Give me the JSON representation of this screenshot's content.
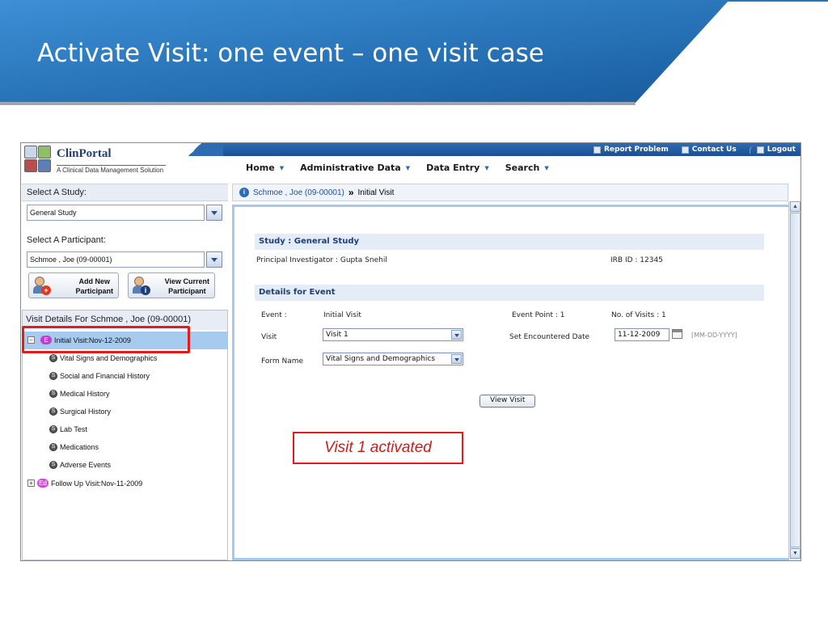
{
  "slide": {
    "title": "Activate Visit: one event – one visit case",
    "callout": "Visit 1 activated"
  },
  "header": {
    "logo_name": "ClinPortal",
    "logo_tagline": "A Clinical Data Management Solution",
    "top_links": [
      "Report Problem",
      "Contact Us",
      "Logout"
    ],
    "menu": [
      "Home",
      "Administrative Data",
      "Data Entry",
      "Search"
    ]
  },
  "left_panel": {
    "study_label": "Select A Study:",
    "study_value": "General Study",
    "participant_label": "Select A Participant:",
    "participant_value": "Schmoe , Joe (09-00001)",
    "add_button": [
      "Add New",
      "Participant"
    ],
    "view_button": [
      "View Current",
      "Participant"
    ],
    "visit_header": "Visit Details For  Schmoe , Joe (09-00001)",
    "tree": {
      "active_badge": "E",
      "active_visit": "Initial Visit:Nov-12-2009",
      "form_badge": "S",
      "forms": [
        "Vital Signs and Demographics",
        "Social and Financial History",
        "Medical History",
        "Surgical History",
        "Lab Test",
        "Medications",
        "Adverse Events"
      ],
      "followup_badge": "Ed",
      "followup_visit": "Follow Up Visit:Nov-11-2009"
    }
  },
  "breadcrumb": {
    "participant": "Schmoe , Joe (09-00001)",
    "separator": "»",
    "current": "Initial Visit"
  },
  "main": {
    "study_title": "Study : General Study",
    "pi": "Principal Investigator : Gupta Snehil",
    "irb": "IRB ID : 12345",
    "event_title": "Details for Event",
    "event_label": "Event :",
    "event_value": "Initial Visit",
    "event_point": "Event Point : 1",
    "num_visits": "No. of Visits : 1",
    "visit_label": "Visit",
    "visit_value": "Visit 1",
    "encounter_label": "Set Encountered Date",
    "encounter_value": "11-12-2009",
    "date_format": "[MM-DD-YYYY]",
    "form_label": "Form Name",
    "form_value": "Vital Signs and Demographics",
    "view_button": "View Visit"
  },
  "colors": {
    "banner": "#1f6fb5",
    "selection": "#a7cbef",
    "annotation_red": "#e21b1b",
    "section_text": "#1d3f7a"
  },
  "icons": [
    "report-problem-icon",
    "contact-us-icon",
    "logout-icon",
    "calendar-icon",
    "info-icon",
    "add-participant-icon",
    "view-participant-icon"
  ]
}
